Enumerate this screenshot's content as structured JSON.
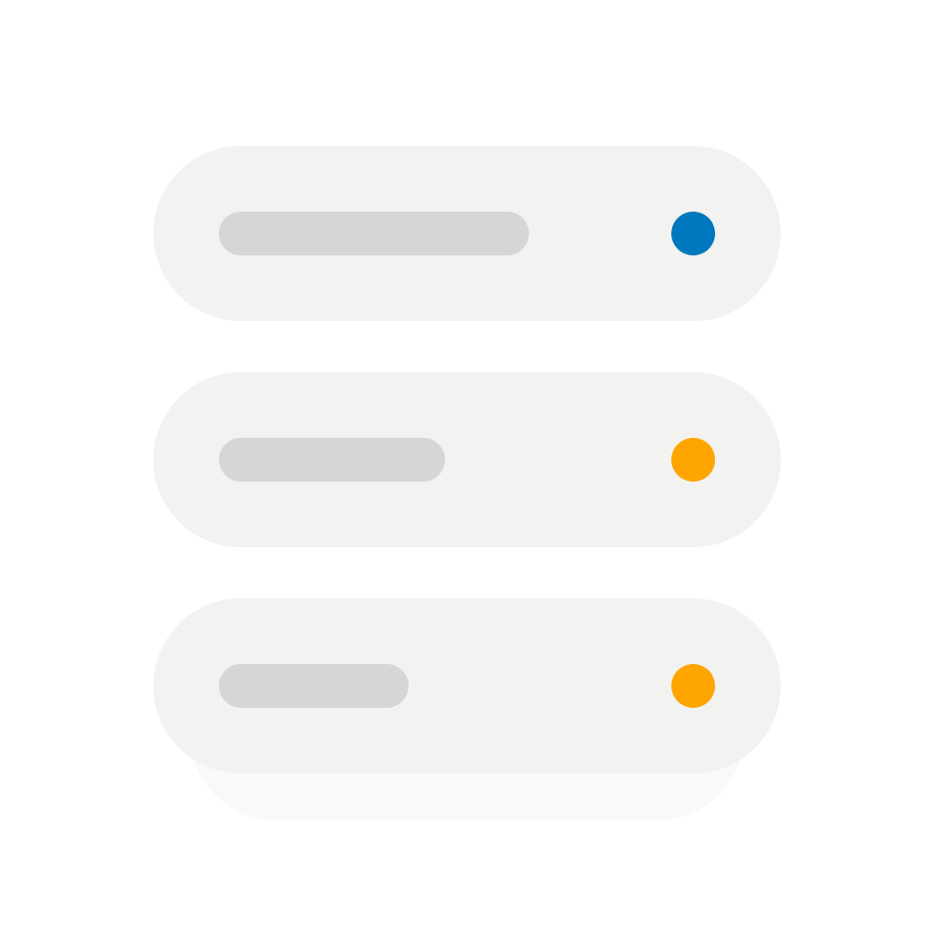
{
  "icon": "server-stack-icon",
  "units": [
    {
      "name": "server-unit-1",
      "status_color": "#0078bd"
    },
    {
      "name": "server-unit-2",
      "status_color": "#ffa500"
    },
    {
      "name": "server-unit-3",
      "status_color": "#ffa500"
    }
  ],
  "colors": {
    "background": "#ffffff",
    "unit_fill": "#f2f2f1",
    "slot_fill": "#d6d6d4",
    "base_shadow": "#f9f9f8"
  }
}
